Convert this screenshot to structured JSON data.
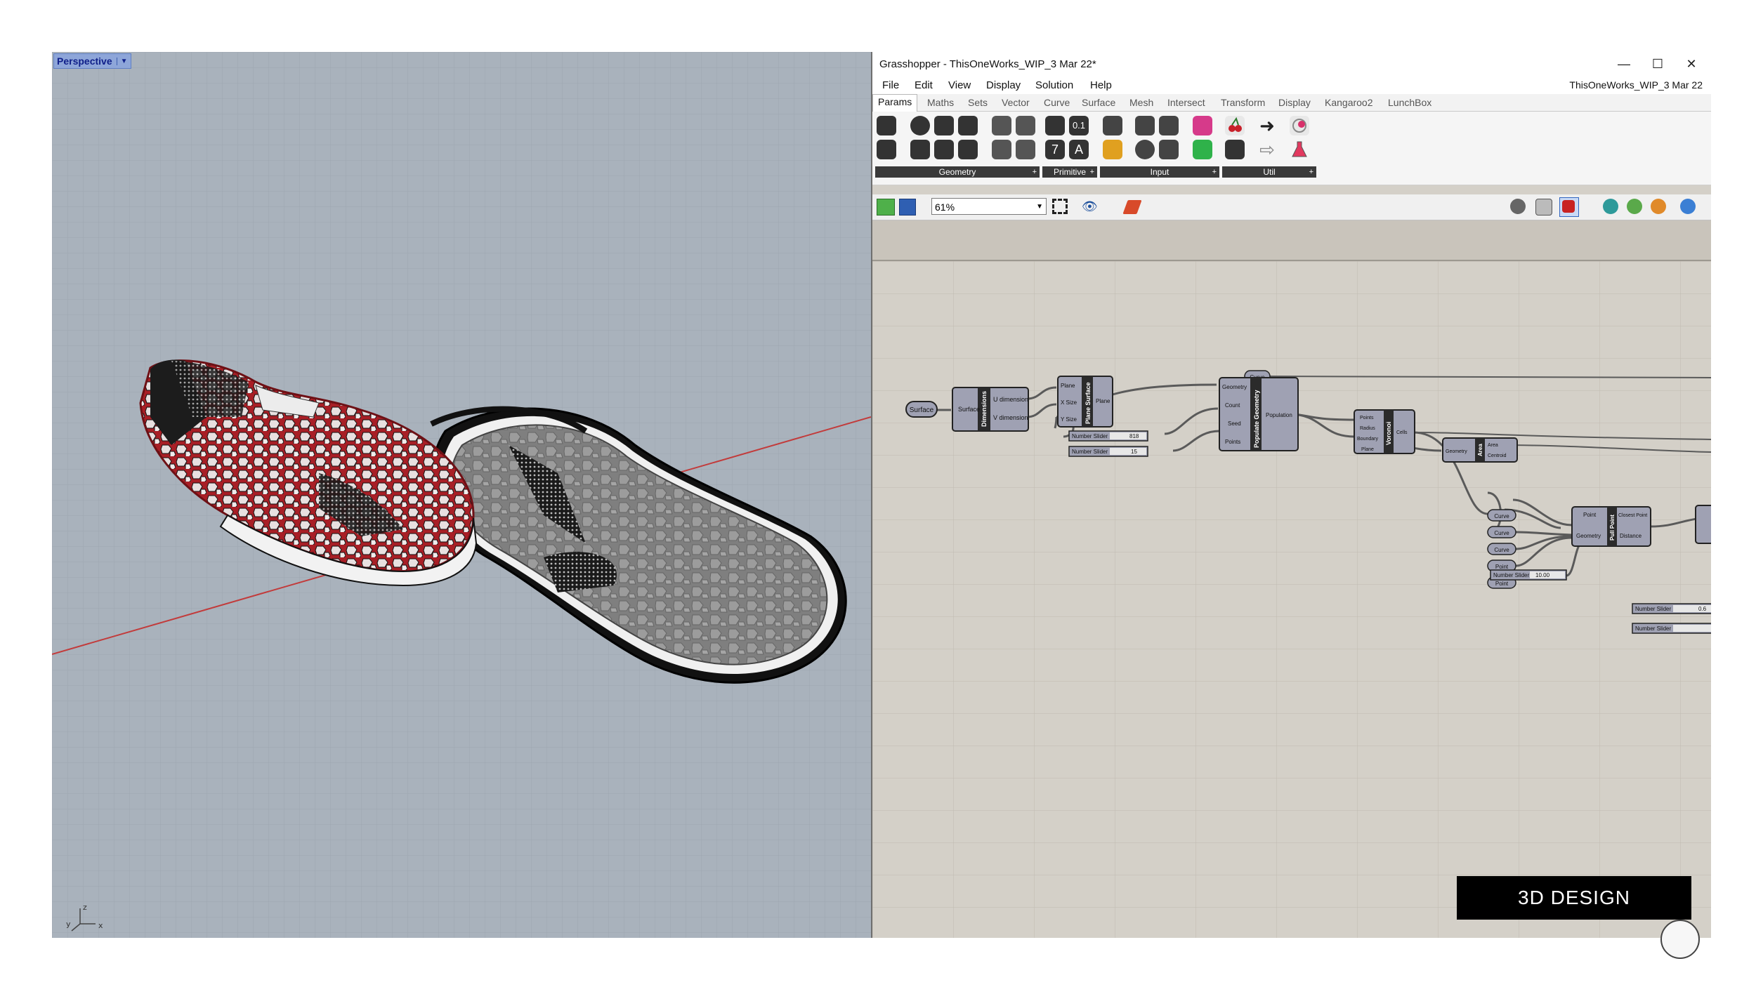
{
  "viewport": {
    "label": "Perspective",
    "axis_labels": {
      "x": "x",
      "y": "y",
      "z": "z"
    }
  },
  "grasshopper": {
    "window_title": "Grasshopper - ThisOneWorks_WIP_3 Mar 22*",
    "window_controls": {
      "minimize": "—",
      "maximize": "☐",
      "close": "✕"
    },
    "menu": [
      "File",
      "Edit",
      "View",
      "Display",
      "Solution",
      "Help"
    ],
    "document_name": "ThisOneWorks_WIP_3 Mar 22",
    "tabs": [
      "Params",
      "Maths",
      "Sets",
      "Vector",
      "Curve",
      "Surface",
      "Mesh",
      "Intersect",
      "Transform",
      "Display",
      "Kangaroo2",
      "LunchBox"
    ],
    "active_tab": "Params",
    "ribbon_groups": [
      {
        "label": "Geometry"
      },
      {
        "label": "Primitive"
      },
      {
        "label": "Input"
      },
      {
        "label": "Util"
      }
    ],
    "ribbon_glyphs": {
      "primitive_number": "0.1",
      "primitive_integer": "7",
      "primitive_text": "A"
    },
    "zoom": "61%",
    "nodes": {
      "surface_param": "Surface",
      "dimensions": {
        "title": "Dimensions",
        "input": "Surface",
        "outputs": [
          "U dimension",
          "V dimension"
        ]
      },
      "plane_surface": {
        "title": "Plane Surface",
        "inputs": [
          "Plane",
          "X Size",
          "Y Size"
        ],
        "output": "Plane"
      },
      "slider1": {
        "label": "Number Slider",
        "value": "818"
      },
      "slider2": {
        "label": "Number Slider",
        "value": "15"
      },
      "populate": {
        "title": "Populate Geometry",
        "inputs": [
          "Geometry",
          "Count",
          "Seed",
          "Points"
        ],
        "output": "Population"
      },
      "curve_param_top": "Curve",
      "voronoi": {
        "title": "Voronoi",
        "inputs": [
          "Points",
          "Radius",
          "Boundary",
          "Plane"
        ],
        "output": "Cells"
      },
      "area": {
        "title": "Area",
        "input": "Geometry",
        "outputs": [
          "Area",
          "Centroid"
        ]
      },
      "pull_point": {
        "title": "Pull Point",
        "inputs": [
          "Point",
          "Geometry"
        ],
        "outputs": [
          "Closest Point",
          "Distance"
        ]
      },
      "params_left": [
        "Curve",
        "Curve",
        "Curve",
        "Point",
        "Point"
      ],
      "slider3": {
        "label": "Number Slider",
        "value": "10.00"
      },
      "slider4": {
        "label": "Number Slider",
        "value": "0.6"
      },
      "slider5": {
        "label": "Number Slider",
        "value": ""
      }
    }
  },
  "overlay": {
    "brand_text": "3D DESIGN"
  },
  "colors": {
    "viewport_bg": "#a6afb9",
    "gh_canvas": "#d4d0c8",
    "shoe_red": "#b02828",
    "node_fill": "#9fa1b3"
  }
}
